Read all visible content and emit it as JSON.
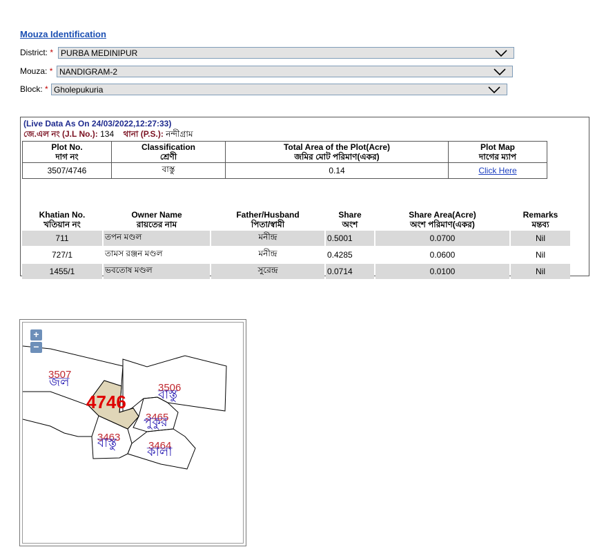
{
  "header": {
    "title": "Mouza Identification"
  },
  "filters": {
    "district": {
      "label": "District:",
      "required_mark": "*",
      "value": "PURBA MEDINIPUR"
    },
    "mouza": {
      "label": "Mouza:",
      "required_mark": "*",
      "value": "NANDIGRAM-2"
    },
    "block": {
      "label": "Block:",
      "required_mark": "*",
      "value": "Gholepukuria"
    }
  },
  "live_data": "(Live Data As On 24/03/2022,12:27:33)",
  "jl": {
    "jl_label": "জে.এল নং (J.L No.):",
    "jl_value": "134",
    "ps_label": "থানা (P.S.):",
    "ps_value": "নন্দীগ্রাম"
  },
  "plot_table": {
    "headers": [
      {
        "en": "Plot No.",
        "bn": "দাগ নং"
      },
      {
        "en": "Classification",
        "bn": "শ্রেণী"
      },
      {
        "en": "Total Area of the Plot(Acre)",
        "bn": "জমির মোট পরিমাণ(একর)"
      },
      {
        "en": "Plot Map",
        "bn": "দাগের ম্যাপ"
      }
    ],
    "row": {
      "plot_no": "3507/4746",
      "classification": "বাস্তু",
      "area": "0.14",
      "map_link": "Click Here"
    }
  },
  "khatian_table": {
    "headers": [
      {
        "en": "Khatian No.",
        "bn": "খতিয়ান নং"
      },
      {
        "en": "Owner Name",
        "bn": "রায়তের নাম"
      },
      {
        "en": "Father/Husband",
        "bn": "পিতা/স্বামী"
      },
      {
        "en": "Share",
        "bn": "অংশ"
      },
      {
        "en": "Share Area(Acre)",
        "bn": "অংশ পরিমাণ(একর)"
      },
      {
        "en": "Remarks",
        "bn": "মন্তব্য"
      }
    ],
    "rows": [
      {
        "khatian": "711",
        "owner": "তপন মণ্ডল",
        "father": "মনীন্দ্র",
        "share": "0.5001",
        "share_area": "0.0700",
        "remarks": "Nil"
      },
      {
        "khatian": "727/1",
        "owner": "তামস রঞ্জন মণ্ডল",
        "father": "মনীন্দ্র",
        "share": "0.4285",
        "share_area": "0.0600",
        "remarks": "Nil"
      },
      {
        "khatian": "1455/1",
        "owner": "ভবতোষ মণ্ডল",
        "father": "সুরেন্দ্র",
        "share": "0.0714",
        "share_area": "0.0100",
        "remarks": "Nil"
      }
    ]
  },
  "map": {
    "zoom_in": "+",
    "zoom_out": "−",
    "highlight_plot": "4746",
    "highlight_color": "#e0d6b8",
    "plots": [
      {
        "number": "3507",
        "class": "জল"
      },
      {
        "number": "3506",
        "class": "বাস্তু"
      },
      {
        "number": "3465",
        "class": "পুকুর"
      },
      {
        "number": "3463",
        "class": "বাস্তু"
      },
      {
        "number": "3464",
        "class": "কালা"
      }
    ]
  },
  "colors": {
    "title": "#1b4fb3",
    "required": "#c00000",
    "row_bg": "#d9d9d9",
    "plot_number": "#c0282f",
    "class_label": "#2b1fb5",
    "highlight_number": "#e00000"
  }
}
